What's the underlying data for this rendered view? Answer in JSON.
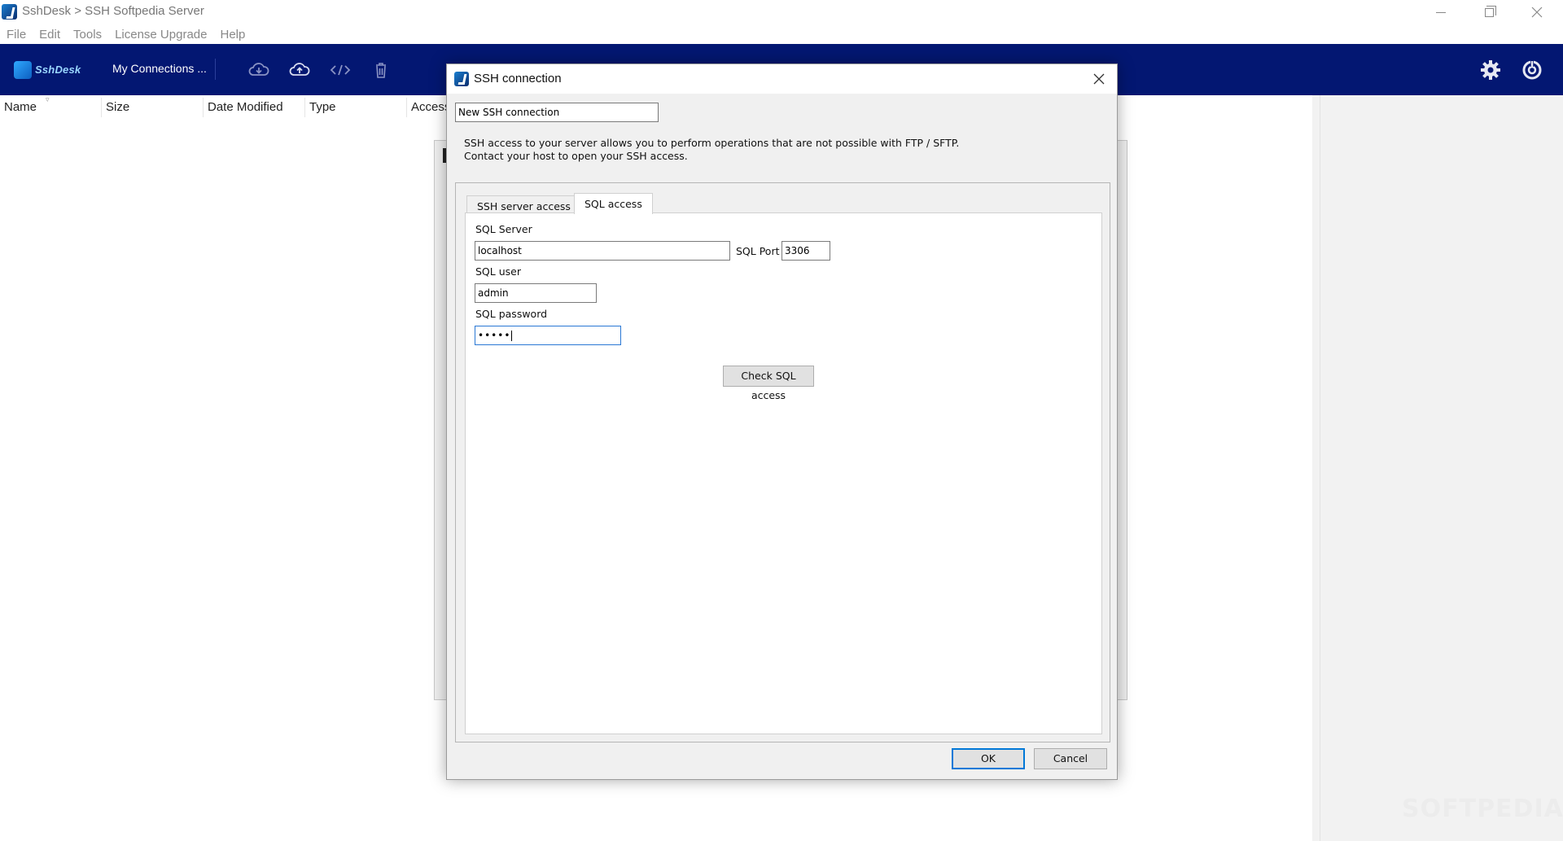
{
  "window": {
    "title": "SshDesk > SSH Softpedia Server"
  },
  "menu": [
    "File",
    "Edit",
    "Tools",
    "License Upgrade",
    "Help"
  ],
  "toolbar": {
    "logo_text": "SshDesk",
    "connections_label": "My Connections ...",
    "icons": [
      "download-icon",
      "upload-icon",
      "code-icon",
      "trash-icon",
      "gear-icon",
      "power-icon"
    ]
  },
  "file_list": {
    "columns": [
      "Name",
      "Size",
      "Date Modified",
      "Type",
      "Access"
    ]
  },
  "dialog": {
    "title": "SSH connection",
    "connection_name": "New SSH connection",
    "info_line1": "SSH access to your server allows you to perform operations that are not possible with FTP / SFTP.",
    "info_line2": "Contact your host to open your SSH access.",
    "tabs": [
      "SSH server access",
      "SQL access"
    ],
    "active_tab": "SQL access",
    "sql_server_label": "SQL Server",
    "sql_server_value": "localhost",
    "sql_port_label": "SQL Port",
    "sql_port_value": "3306",
    "sql_user_label": "SQL user",
    "sql_user_value": "admin",
    "sql_password_label": "SQL password",
    "sql_password_value": "•••••",
    "check_button": "Check SQL access",
    "ok_button": "OK",
    "cancel_button": "Cancel"
  },
  "watermark": "SOFTPEDIA",
  "colors": {
    "toolbar_bg": "#031772",
    "accent": "#0078d7",
    "dialog_bg": "#f0f0f0"
  }
}
